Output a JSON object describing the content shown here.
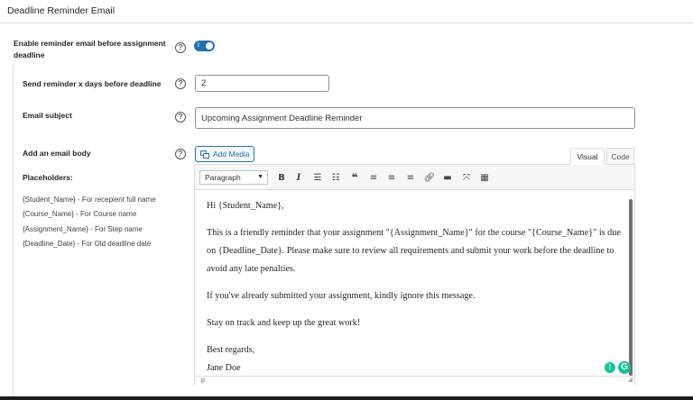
{
  "panel": {
    "title": "Deadline Reminder Email"
  },
  "fields": {
    "enable": {
      "label": "Enable reminder email before assignment deadline",
      "toggle_mark": "I"
    },
    "days": {
      "label": "Send reminder x days before deadline",
      "value": "2"
    },
    "subject": {
      "label": "Email subject",
      "value": "Upcoming Assignment Deadline Reminder"
    },
    "body": {
      "label": "Add an email body"
    }
  },
  "help_glyph": "?",
  "placeholders": {
    "title": "Placeholders:",
    "items": [
      "{Student_Name} - For recepient full name",
      "{Course_Name} - For Course name",
      "{Assignment_Name} - For Step name",
      "{Deadline_Date} - For Old deadline date"
    ]
  },
  "editor": {
    "add_media_label": "Add Media",
    "tabs": [
      "Visual",
      "Code"
    ],
    "format_value": "Paragraph",
    "toolbar_icons": [
      "bold-icon",
      "italic-icon",
      "bulleted-list-icon",
      "numbered-list-icon",
      "blockquote-icon",
      "align-left-icon",
      "align-center-icon",
      "align-right-icon",
      "link-icon",
      "horizontal-rule-icon",
      "fullscreen-icon",
      "toolbar-toggle-icon"
    ],
    "paragraphs": [
      "Hi {Student_Name},",
      "This is a friendly reminder that your assignment \"{Assignment_Name}\" for the course \"{Course_Name}\" is due on {Deadline_Date}. Please make sure to review all requirements and submit your work before the deadline to avoid any late penalties.",
      "If you've already submitted your assignment, kindly ignore this message.",
      "Stay on track and keep up the great work!"
    ],
    "signoff": "Best regards,",
    "signature": "Jane Doe",
    "status_path": "p"
  },
  "colors": {
    "accent": "#2271b1",
    "grammarly": "#15c39a",
    "border": "#dcdcde"
  }
}
